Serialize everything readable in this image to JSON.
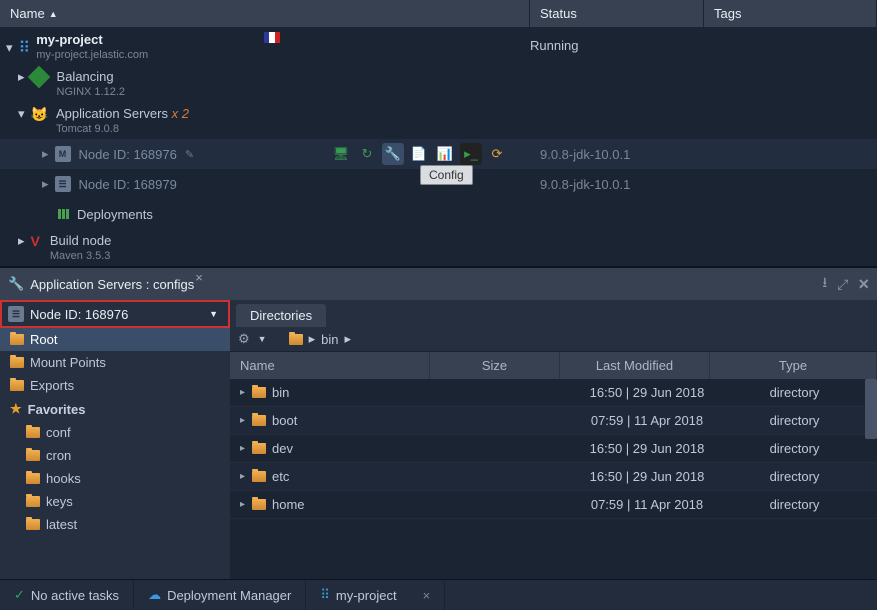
{
  "columns": {
    "name": "Name",
    "status": "Status",
    "tags": "Tags"
  },
  "env": {
    "title": "my-project",
    "subtitle": "my-project.jelastic.com",
    "status": "Running"
  },
  "balancing": {
    "title": "Balancing",
    "subtitle": "NGINX 1.12.2"
  },
  "appservers": {
    "title": "Application Servers",
    "count": "x 2",
    "subtitle": "Tomcat 9.0.8",
    "node1": "Node ID: 168976",
    "node2": "Node ID: 168979",
    "tag": "9.0.8-jdk-10.0.1"
  },
  "deployments": "Deployments",
  "buildnode": {
    "title": "Build node",
    "subtitle": "Maven 3.5.3"
  },
  "tooltip": "Config",
  "configs": {
    "title": "Application Servers : configs",
    "node": "Node ID: 168976",
    "root": "Root",
    "mounts": "Mount Points",
    "exports": "Exports",
    "favorites": "Favorites",
    "favs": [
      "conf",
      "cron",
      "hooks",
      "keys",
      "latest"
    ],
    "dirtab": "Directories",
    "crumb": "bin",
    "fileHeaders": {
      "name": "Name",
      "size": "Size",
      "mod": "Last Modified",
      "type": "Type"
    },
    "rows": [
      {
        "name": "bin",
        "mod": "16:50 | 29 Jun 2018",
        "type": "directory"
      },
      {
        "name": "boot",
        "mod": "07:59 | 11 Apr 2018",
        "type": "directory"
      },
      {
        "name": "dev",
        "mod": "16:50 | 29 Jun 2018",
        "type": "directory"
      },
      {
        "name": "etc",
        "mod": "16:50 | 29 Jun 2018",
        "type": "directory"
      },
      {
        "name": "home",
        "mod": "07:59 | 11 Apr 2018",
        "type": "directory"
      }
    ]
  },
  "bottom": {
    "tasks": "No active tasks",
    "dm": "Deployment Manager",
    "proj": "my-project"
  }
}
